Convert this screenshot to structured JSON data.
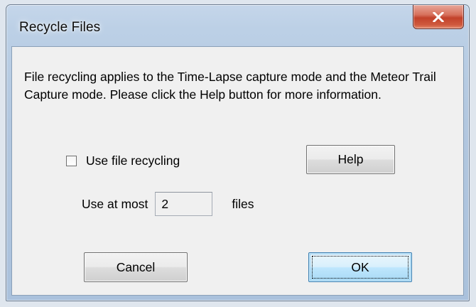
{
  "window": {
    "title": "Recycle Files"
  },
  "dialog": {
    "description": "File recycling applies to the Time-Lapse capture mode and the Meteor Trail Capture mode.  Please click the Help button for more information.",
    "use_recycling_label": "Use file recycling",
    "use_recycling_checked": false,
    "use_at_most_label": "Use at most",
    "max_files_value": "2",
    "files_label": "files",
    "help_label": "Help",
    "cancel_label": "Cancel",
    "ok_label": "OK"
  },
  "icons": {
    "close": "close-icon",
    "checkbox": "checkbox-unchecked"
  },
  "colors": {
    "close_button": "#c2412a",
    "client_background": "#f0f0f0",
    "titlebar": "#b2c7df",
    "default_button_border": "#3c7fb1"
  }
}
